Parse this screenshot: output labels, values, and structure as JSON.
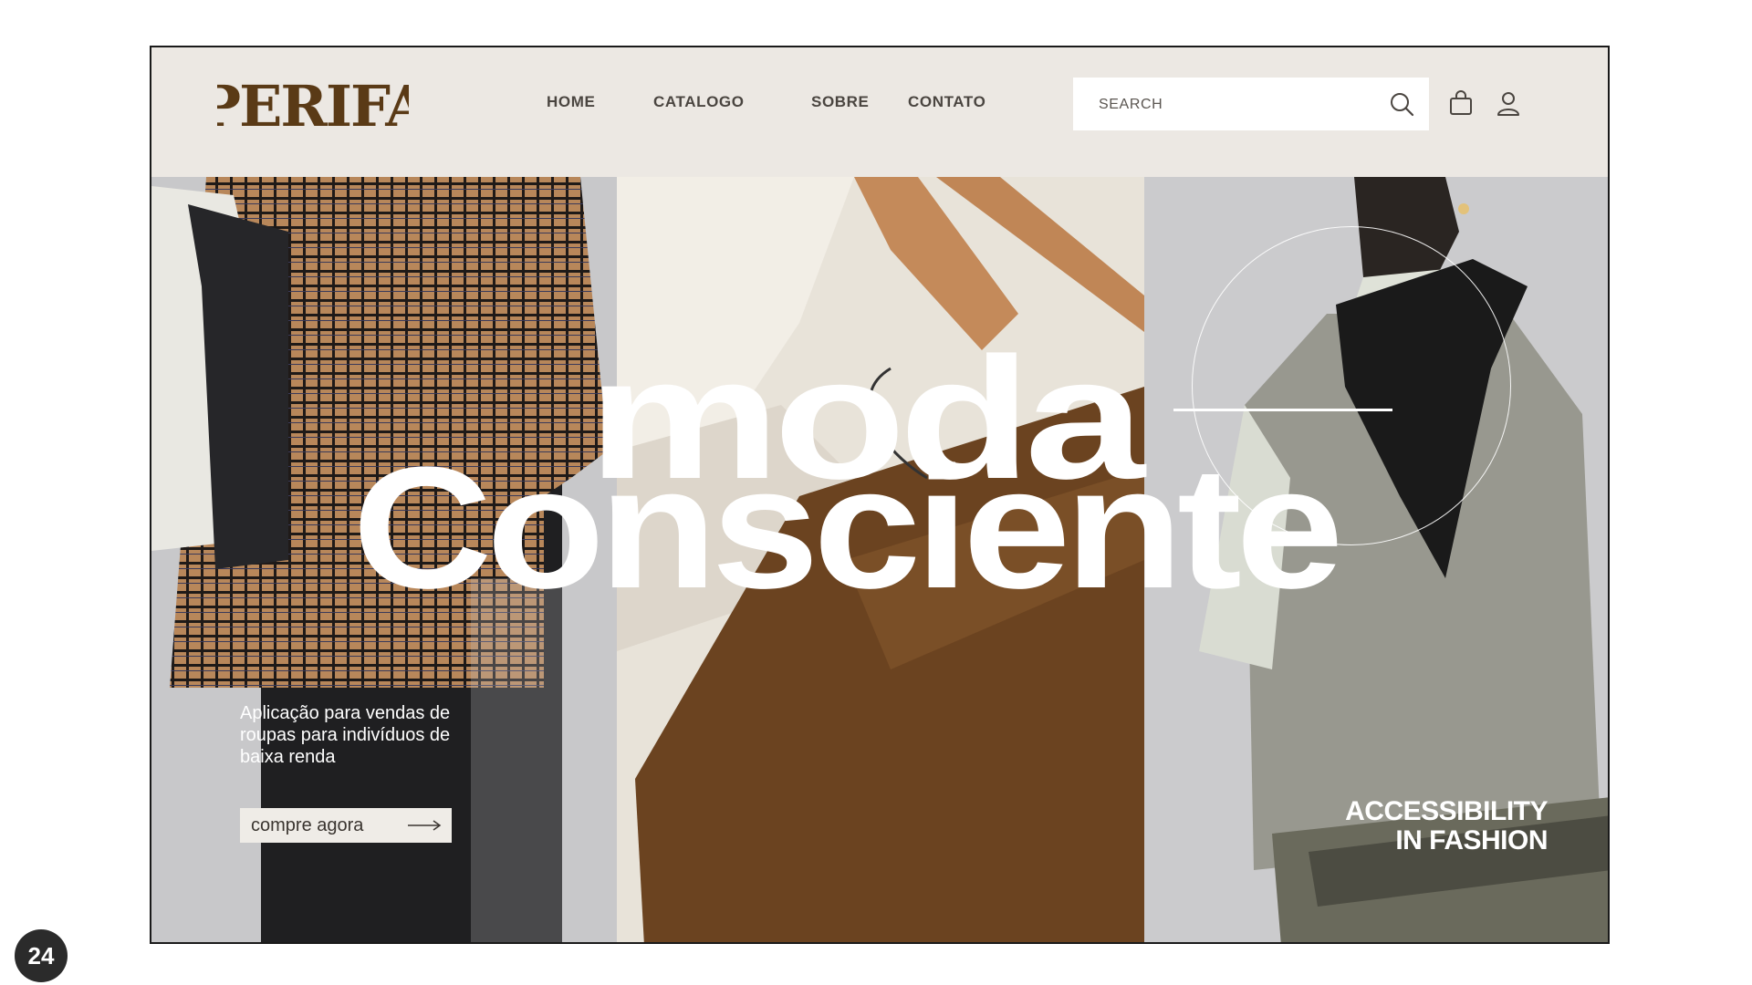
{
  "brand": {
    "logo_text": "PERIFA",
    "logo_color": "#5a3a16"
  },
  "nav": {
    "items": [
      "HOME",
      "CATALOGO",
      "SOBRE",
      "CONTATO"
    ]
  },
  "search": {
    "placeholder": "SEARCH"
  },
  "icons": {
    "search": "search-icon",
    "cart": "shopping-bag-icon",
    "user": "user-icon",
    "cta_arrow": "arrow-right-icon"
  },
  "hero": {
    "headline_line1": "moda",
    "headline_line2": "Consciente",
    "tagline": "Aplicação para vendas de roupas para indivíduos de baixa renda",
    "cta_label": "compre agora",
    "accessibility_line1": "ACCESSIBILITY",
    "accessibility_line2": "IN FASHION"
  },
  "colors": {
    "header_bg": "#ece8e3",
    "brown": "#5a3a16",
    "text_dark": "#4a4540"
  },
  "slide_number": "24"
}
